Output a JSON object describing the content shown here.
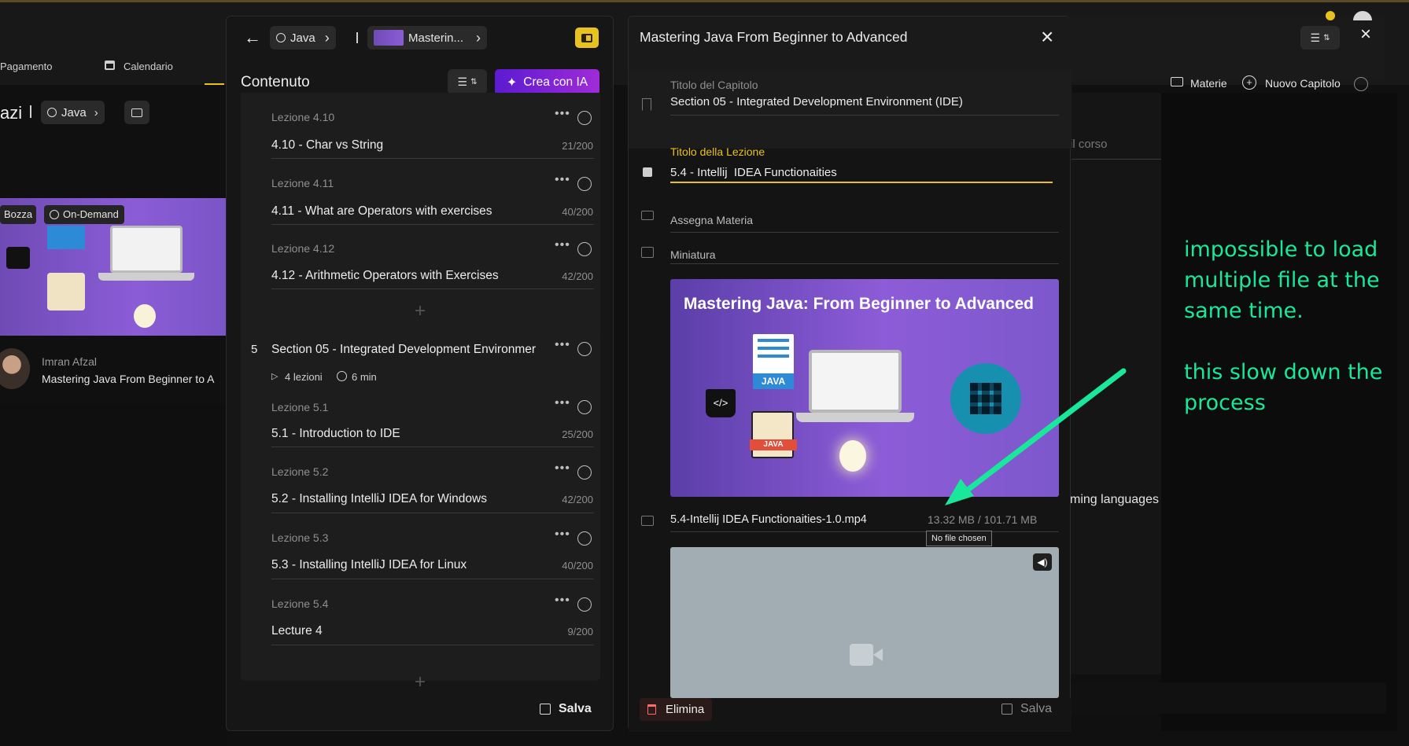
{
  "background": {
    "tabs": {
      "payment": "Pagamento",
      "calendar": "Calendario"
    },
    "breadcrumb": {
      "prefix": "azi",
      "course": "Java"
    },
    "badges": {
      "draft": "Bozza",
      "ondemand": "On-Demand"
    },
    "author": {
      "name": "Imran Afzal",
      "course_title": "Mastering Java From Beginner to A"
    },
    "toolbar": {
      "subjects": "Materie",
      "new_chapter": "Nuovo Capitolo"
    },
    "partial_text": {
      "course_hint": "il corso",
      "languages": "ming languages"
    }
  },
  "content_panel": {
    "breadcrumb": {
      "course": "Java",
      "title": "Masterin..."
    },
    "title": "Contenuto",
    "ai_button": "Crea con IA",
    "save": "Salva",
    "section4_lessons": [
      {
        "label": "Lezione 4.10",
        "title": "4.10 - Char vs String",
        "count": "21/200"
      },
      {
        "label": "Lezione 4.11",
        "title": "4.11 - What are Operators with exercises",
        "count": "40/200"
      },
      {
        "label": "Lezione 4.12",
        "title": "4.12 - Arithmetic Operators with Exercises",
        "count": "42/200"
      }
    ],
    "section5": {
      "number": "5",
      "title": "Section 05 - Integrated Development Environmer",
      "lessons_count": "4 lezioni",
      "duration": "6 min",
      "lessons": [
        {
          "label": "Lezione 5.1",
          "title": "5.1 - Introduction to IDE",
          "count": "25/200"
        },
        {
          "label": "Lezione 5.2",
          "title": "5.2 - Installing IntelliJ IDEA for Windows",
          "count": "42/200"
        },
        {
          "label": "Lezione 5.3",
          "title": "5.3 - Installing IntelliJ IDEA for Linux",
          "count": "40/200"
        },
        {
          "label": "Lezione 5.4",
          "title": "Lecture 4",
          "count": "9/200"
        }
      ]
    }
  },
  "detail_panel": {
    "title": "Mastering Java From Beginner to Advanced",
    "chapter_label": "Titolo del Capitolo",
    "chapter_value": "Section 05 - Integrated Development Environment (IDE)",
    "lesson_label": "Titolo della Lezione",
    "lesson_value": "5.4 - Intellij  IDEA Functionaities",
    "assign_subject": "Assegna Materia",
    "thumbnail_label": "Miniatura",
    "thumbnail_heading": "Mastering Java: From Beginner to Advanced",
    "file_name": "5.4-Intellij IDEA Functionaities-1.0.mp4",
    "file_size": "13.32 MB / 101.71 MB",
    "tooltip": "No file chosen",
    "delete": "Elimina",
    "save": "Salva"
  },
  "annotation": {
    "line1": "impossible to load",
    "line2": "multiple file at the",
    "line3": "same time.",
    "line4": "this slow down the",
    "line5": "process",
    "color": "#19e89a"
  },
  "colors": {
    "accent_yellow": "#e8c21e",
    "ai_purple": "#8a2be2",
    "panel_bg": "#161616",
    "card_bg": "#1d1d1d"
  }
}
